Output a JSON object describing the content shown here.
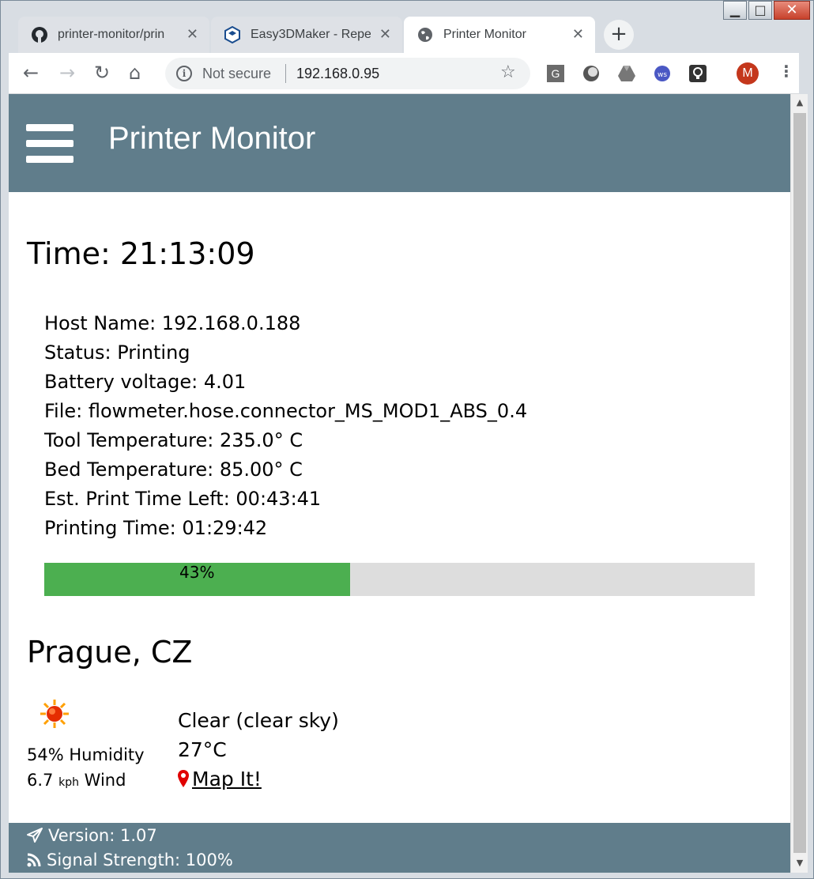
{
  "window": {
    "minimize_glyph": "▁",
    "maximize_glyph": "□",
    "close_glyph": "✕"
  },
  "tabs": [
    {
      "title": "printer-monitor/prin",
      "icon": "github-icon",
      "close": "✕"
    },
    {
      "title": "Easy3DMaker - Repe",
      "icon": "cube-icon",
      "close": "✕"
    },
    {
      "title": "Printer Monitor",
      "icon": "globe-icon",
      "close": "✕",
      "active": true
    }
  ],
  "new_tab_label": "+",
  "toolbar": {
    "back": "←",
    "forward": "→",
    "reload": "↻",
    "home": "⌂",
    "security_label": "Not secure",
    "url": "192.168.0.95",
    "star": "☆",
    "extensions": [
      "G"
    ],
    "avatar_letter": "M",
    "menu": "⋮"
  },
  "page": {
    "title": "Printer Monitor",
    "time": "Time: 21:13:09",
    "info_lines": [
      "Host Name: 192.168.0.188",
      "Status: Printing",
      "Battery voltage: 4.01",
      "File: flowmeter.hose.connector_MS_MOD1_ABS_0.4",
      "Tool Temperature: 235.0° C",
      "Bed Temperature: 85.00° C",
      "Est. Print Time Left: 00:43:41",
      "Printing Time: 01:29:42"
    ],
    "progress": {
      "percent": 43,
      "label": "43%"
    },
    "weather": {
      "city": "Prague, CZ",
      "humidity": "54% Humidity",
      "wind_value": "6.7",
      "wind_unit": "kph",
      "wind_label": "Wind",
      "condition": "Clear (clear sky)",
      "temperature": "27°C",
      "map_link": " Map It!"
    },
    "footer": {
      "version": "Version: 1.07",
      "signal": "Signal Strength: 100%"
    }
  },
  "colors": {
    "header": "#607d8b",
    "progress_fill": "#4caf50",
    "progress_track": "#dddddd",
    "pin": "#e00000"
  }
}
